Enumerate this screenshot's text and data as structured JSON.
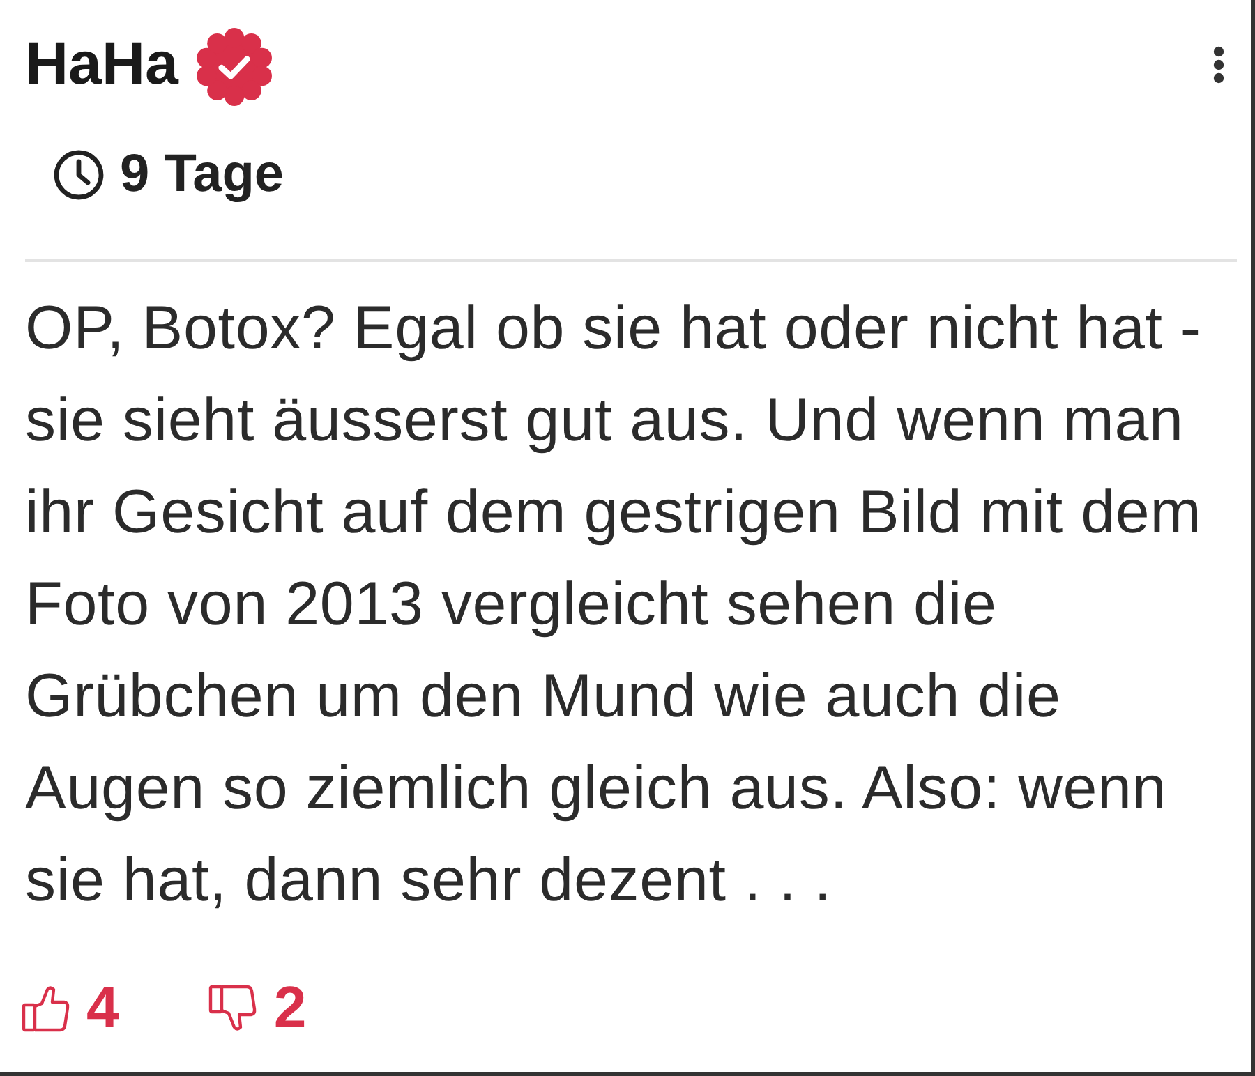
{
  "post": {
    "author": "HaHa",
    "verified": true,
    "time": "9 Tage",
    "body": "OP, Botox? Egal ob sie hat oder nicht hat - sie sieht äusserst gut aus. Und wenn man ihr Gesicht auf dem gestrigen Bild mit dem Foto von 2013 vergleicht sehen die Grübchen um den Mund wie auch die Augen so ziemlich gleich aus. Also: wenn sie hat, dann sehr dezent . . .",
    "reactions": [
      {
        "kind": "like",
        "count": "4"
      },
      {
        "kind": "dislike",
        "count": "2"
      }
    ]
  }
}
